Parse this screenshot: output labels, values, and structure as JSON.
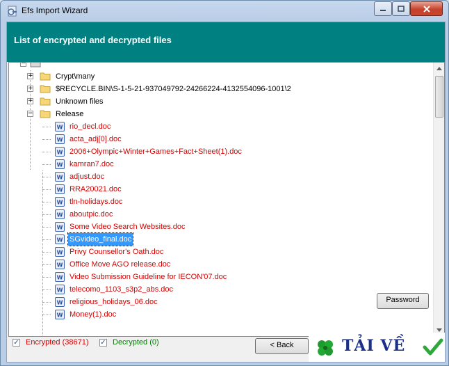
{
  "window": {
    "title": "Efs Import Wizard",
    "banner_title": "List of encrypted and decrypted files"
  },
  "tree": {
    "folders": [
      {
        "label": "Crypt\\many"
      },
      {
        "label": "$RECYCLE.BIN\\S-1-5-21-937049792-24266224-4132554096-1001\\2"
      },
      {
        "label": "Unknown files"
      },
      {
        "label": "Release"
      }
    ],
    "files": [
      {
        "label": "rio_decl.doc"
      },
      {
        "label": "acta_adj[0].doc"
      },
      {
        "label": "2006+Olympic+Winter+Games+Fact+Sheet(1).doc"
      },
      {
        "label": "kamran7.doc"
      },
      {
        "label": "adjust.doc"
      },
      {
        "label": "RRA20021.doc"
      },
      {
        "label": "tln-holidays.doc"
      },
      {
        "label": "aboutpic.doc"
      },
      {
        "label": "Some Video Search Websites.doc"
      },
      {
        "label": "SGvideo_final.doc"
      },
      {
        "label": "Privy Counsellor's Oath.doc"
      },
      {
        "label": "Office Move AGO release.doc"
      },
      {
        "label": "Video Submission Guideline for IECON'07.doc"
      },
      {
        "label": "telecomo_1103_s3p2_abs.doc"
      },
      {
        "label": "religious_holidays_06.doc"
      },
      {
        "label": "Money(1).doc"
      }
    ],
    "selected_file": "SGvideo_final.doc"
  },
  "buttons": {
    "password": "Password",
    "back": "< Back"
  },
  "filters": {
    "encrypted_label": "Encrypted (38671)",
    "decrypted_label": "Decrypted (0)",
    "encrypted_checked": true,
    "decrypted_checked": true
  },
  "logo": {
    "text": "TẢI VỀ"
  },
  "colors": {
    "banner": "#008080",
    "encrypted_text": "#d40000",
    "decrypted_text": "#008000",
    "selection": "#3399ff"
  }
}
